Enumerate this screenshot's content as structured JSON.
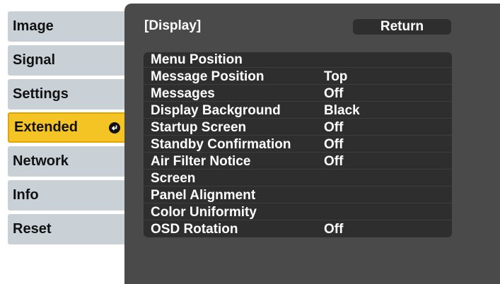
{
  "sidebar": {
    "tabs": [
      {
        "label": "Image"
      },
      {
        "label": "Signal"
      },
      {
        "label": "Settings"
      },
      {
        "label": "Extended"
      },
      {
        "label": "Network"
      },
      {
        "label": "Info"
      },
      {
        "label": "Reset"
      }
    ],
    "active_tab": "Extended",
    "active_icon": "enter-icon"
  },
  "panel": {
    "title": "[Display]",
    "return_label": "Return",
    "items": [
      {
        "label": "Menu Position",
        "value": ""
      },
      {
        "label": "Message Position",
        "value": "Top"
      },
      {
        "label": "Messages",
        "value": "Off"
      },
      {
        "label": "Display Background",
        "value": "Black"
      },
      {
        "label": "Startup Screen",
        "value": "Off"
      },
      {
        "label": "Standby Confirmation",
        "value": "Off"
      },
      {
        "label": "Air Filter Notice",
        "value": "Off"
      },
      {
        "label": "Screen",
        "value": ""
      },
      {
        "label": "Panel Alignment",
        "value": ""
      },
      {
        "label": "Color Uniformity",
        "value": ""
      },
      {
        "label": "OSD Rotation",
        "value": "Off"
      }
    ]
  },
  "colors": {
    "active_tab": "#f4c425",
    "tab": "#c9d1d6",
    "panel": "#4a4a4a",
    "item_bg": "#2e2e2e"
  }
}
